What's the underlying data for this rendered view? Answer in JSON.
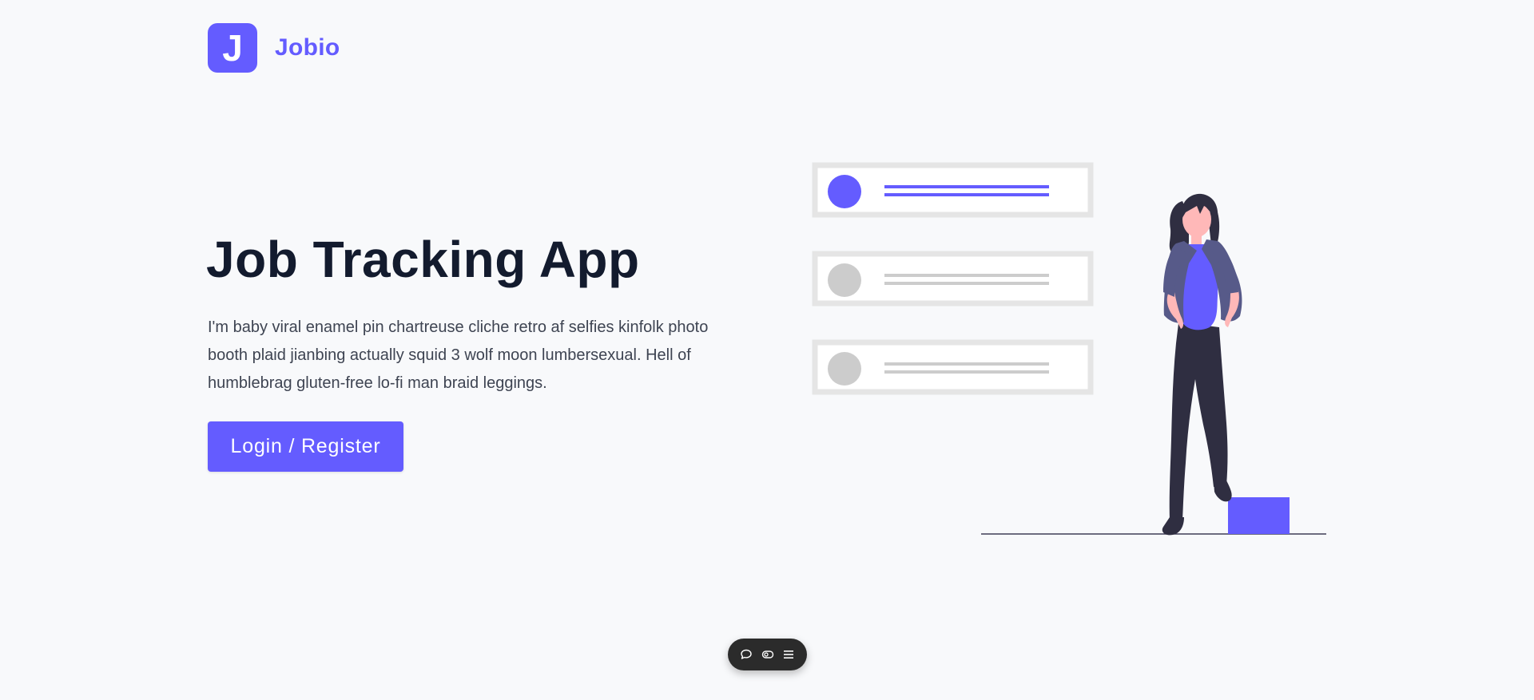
{
  "header": {
    "logo_letter": "J",
    "brand_name": "Jobio"
  },
  "hero": {
    "title": "Job Tracking App",
    "description": "I'm baby viral enamel pin chartreuse cliche retro af selfies kinfolk photo booth plaid jianbing actually squid 3 wolf moon lumbersexual. Hell of humblebrag gluten-free lo-fi man braid leggings.",
    "cta_label": "Login / Register"
  },
  "illustration": {
    "name": "woman-standing-beside-job-list-illustration",
    "cards": [
      {
        "state": "active"
      },
      {
        "state": "inactive"
      },
      {
        "state": "inactive"
      }
    ]
  },
  "floating_toolbar": {
    "buttons": [
      {
        "icon": "comment-icon"
      },
      {
        "icon": "toggle-icon"
      },
      {
        "icon": "menu-icon"
      }
    ]
  },
  "colors": {
    "primary": "#645cff",
    "heading": "#131b2e",
    "text": "#3e4452",
    "background": "#f8f9fb",
    "card_border": "#e5e5e5",
    "placeholder_gray": "#cccccc",
    "figure_dark": "#2f2e41",
    "jacket": "#575a89",
    "skin": "#ffb8b8",
    "toolbar_bg": "#2b2b2b"
  }
}
